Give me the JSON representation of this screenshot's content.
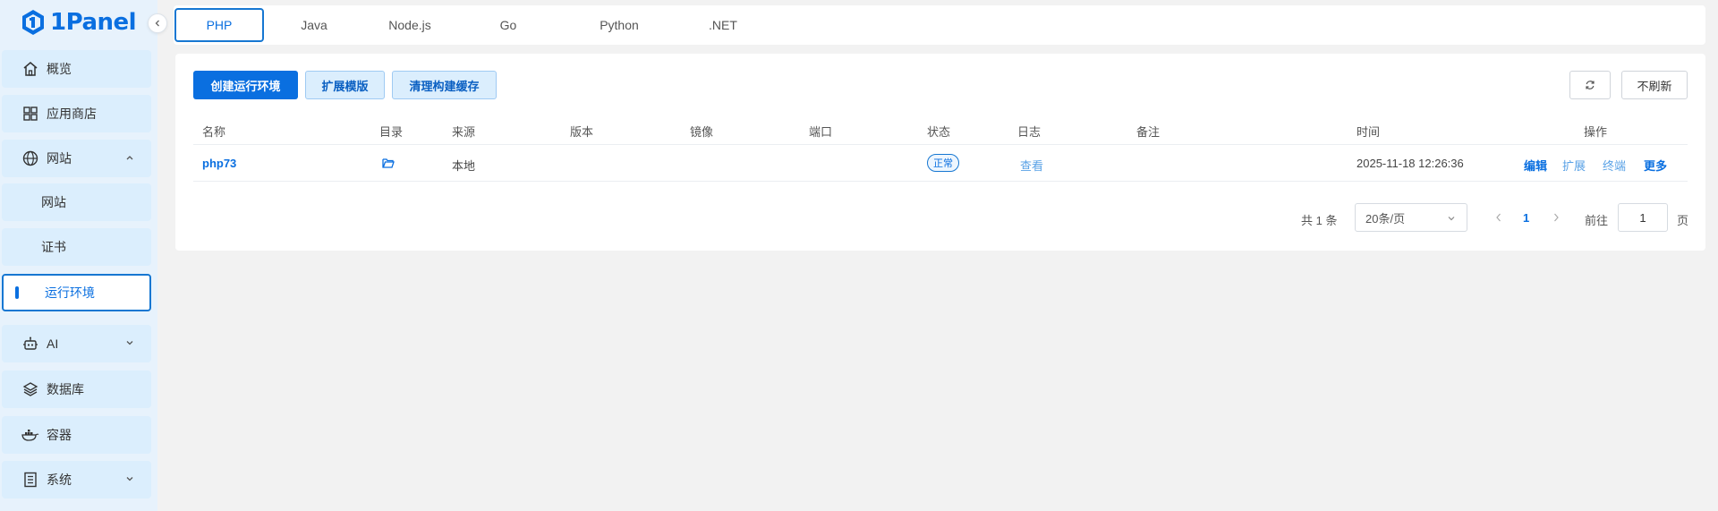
{
  "app": {
    "logo_text": "1Panel"
  },
  "sidebar": {
    "items": [
      {
        "label": "概览",
        "icon": "home-icon"
      },
      {
        "label": "应用商店",
        "icon": "grid-icon"
      },
      {
        "label": "网站",
        "icon": "globe-icon",
        "expanded": true
      },
      {
        "label": "AI",
        "icon": "robot-icon"
      },
      {
        "label": "数据库",
        "icon": "layers-icon"
      },
      {
        "label": "容器",
        "icon": "docker-icon"
      },
      {
        "label": "系统",
        "icon": "system-icon"
      }
    ],
    "subitems": [
      {
        "label": "网站"
      },
      {
        "label": "证书"
      },
      {
        "label": "运行环境",
        "active": true
      }
    ]
  },
  "tabs": [
    "PHP",
    "Java",
    "Node.js",
    "Go",
    "Python",
    ".NET"
  ],
  "active_tab": "PHP",
  "toolbar": {
    "create_label": "创建运行环境",
    "extend_label": "扩展模版",
    "clear_label": "清理构建缓存",
    "refresh_mode_label": "不刷新"
  },
  "table": {
    "columns": [
      "名称",
      "目录",
      "来源",
      "版本",
      "镜像",
      "端口",
      "状态",
      "日志",
      "备注",
      "时间",
      "操作"
    ],
    "rows": [
      {
        "name": "php73",
        "source": "本地",
        "version": "",
        "image": "",
        "port": "",
        "status": "正常",
        "log": "查看",
        "remark": "",
        "time": "2025-11-18 12:26:36",
        "actions": [
          "编辑",
          "扩展",
          "终端",
          "更多"
        ]
      }
    ]
  },
  "pagination": {
    "total_prefix": "共",
    "total": "1",
    "total_suffix": "条",
    "page_size": "20条/页",
    "current_page": "1",
    "goto_label": "前往",
    "goto_value": "1",
    "page_suffix": "页"
  },
  "colors": {
    "accent": "#0a6fe0",
    "sidebar_bg": "#e7f2fc",
    "item_bg": "#dbeefd",
    "page_bg": "#f2f2f2"
  }
}
